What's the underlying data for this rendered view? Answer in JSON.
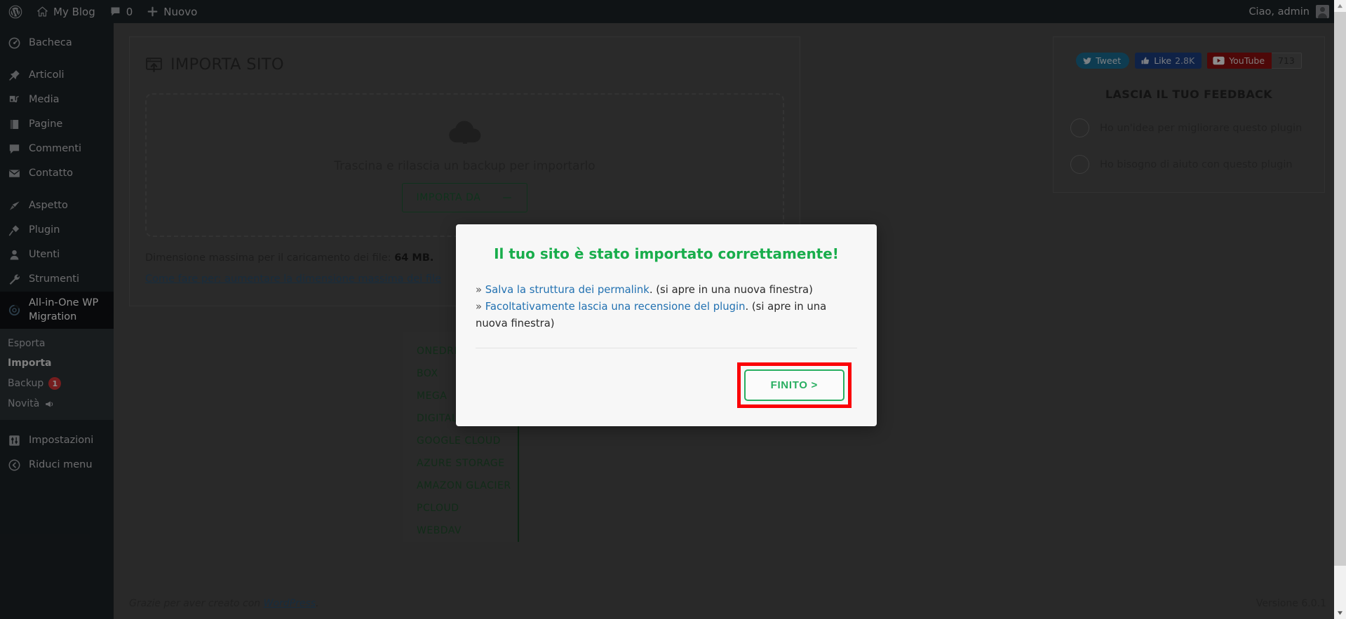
{
  "adminbar": {
    "logo_icon": "wordpress-logo-icon",
    "home_icon": "home-icon",
    "site_name": "My Blog",
    "comments_icon": "comment-bubble-icon",
    "comments_count": "0",
    "new_icon": "plus-icon",
    "new_label": "Nuovo",
    "greeting": "Ciao, admin",
    "avatar_icon": "user-avatar-icon"
  },
  "sidebar": {
    "items": [
      {
        "label": "Bacheca",
        "icon": "dashboard-gauge-icon",
        "gap": true
      },
      {
        "label": "Articoli",
        "icon": "pin-icon",
        "gap": true
      },
      {
        "label": "Media",
        "icon": "media-music-icon",
        "gap": false
      },
      {
        "label": "Pagine",
        "icon": "pages-icon",
        "gap": false
      },
      {
        "label": "Commenti",
        "icon": "comment-bubble-icon",
        "gap": false
      },
      {
        "label": "Contatto",
        "icon": "envelope-icon",
        "gap": false
      },
      {
        "label": "Aspetto",
        "icon": "paintbrush-icon",
        "gap": true
      },
      {
        "label": "Plugin",
        "icon": "plug-icon",
        "gap": false
      },
      {
        "label": "Utenti",
        "icon": "user-icon",
        "gap": false
      },
      {
        "label": "Strumenti",
        "icon": "wrench-icon",
        "gap": false
      }
    ],
    "current": {
      "label": "All-in-One WP Migration",
      "icon": "aiowpm-swirl-icon"
    },
    "submenu": [
      {
        "label": "Esporta",
        "active": false,
        "badge": null,
        "icon": null
      },
      {
        "label": "Importa",
        "active": true,
        "badge": null,
        "icon": null
      },
      {
        "label": "Backup",
        "active": false,
        "badge": "1",
        "icon": null
      },
      {
        "label": "Novità",
        "active": false,
        "badge": null,
        "icon": "megaphone-icon"
      }
    ],
    "bottom_items": [
      {
        "label": "Impostazioni",
        "icon": "settings-sliders-icon"
      },
      {
        "label": "Riduci menu",
        "icon": "collapse-arrow-icon"
      }
    ]
  },
  "import_panel": {
    "title": "IMPORTA SITO",
    "title_icon": "import-window-upload-icon",
    "dropzone_icon": "cloud-upload-icon",
    "dropzone_text": "Trascina e rilascia un backup per importarlo",
    "import_from_label": "IMPORTA DA",
    "import_from_toggle_icon": "minus-icon",
    "max_size_prefix": "Dimensione massima per il caricamento dei file: ",
    "max_size_value": "64 MB.",
    "howto_link": "Come fare per: aumentare la dimensione massima dei file"
  },
  "providers": [
    "ONEDRIVE",
    "BOX",
    "MEGA",
    "DIGITALOCEAN",
    "GOOGLE CLOUD",
    "AZURE STORAGE",
    "AMAZON GLACIER",
    "PCLOUD",
    "WEBDAV"
  ],
  "feedback": {
    "tweet_label": "Tweet",
    "tweet_icon": "twitter-bird-icon",
    "like_label": "Like",
    "like_count": "2.8K",
    "like_icon": "thumbs-up-icon",
    "youtube_label": "YouTube",
    "youtube_icon": "youtube-play-icon",
    "youtube_count": "713",
    "title": "LASCIA IL TUO FEEDBACK",
    "options": [
      "Ho un'idea per migliorare questo plugin",
      "Ho bisogno di aiuto con questo plugin"
    ]
  },
  "modal": {
    "title": "Il tuo sito è stato importato correttamente!",
    "lines": [
      {
        "bullet": "»",
        "link": "Salva la struttura dei permalink",
        "rest": ". (si apre in una nuova finestra)"
      },
      {
        "bullet": "»",
        "link": "Facoltativamente lascia una recensione del plugin",
        "rest": ". (si apre in una nuova finestra)"
      }
    ],
    "finish_label": "FINITO >"
  },
  "footer": {
    "thanks_prefix": "Grazie per aver creato con ",
    "thanks_link": "WordPress",
    "thanks_suffix": ".",
    "version": "Versione 6.0.1"
  },
  "colors": {
    "wp_sidebar": "#1d2327",
    "accent_green": "#27ae60",
    "title_green": "#18ad4b",
    "link_blue": "#2271b1",
    "highlight_red": "#fb0007",
    "badge_red": "#d63638"
  }
}
